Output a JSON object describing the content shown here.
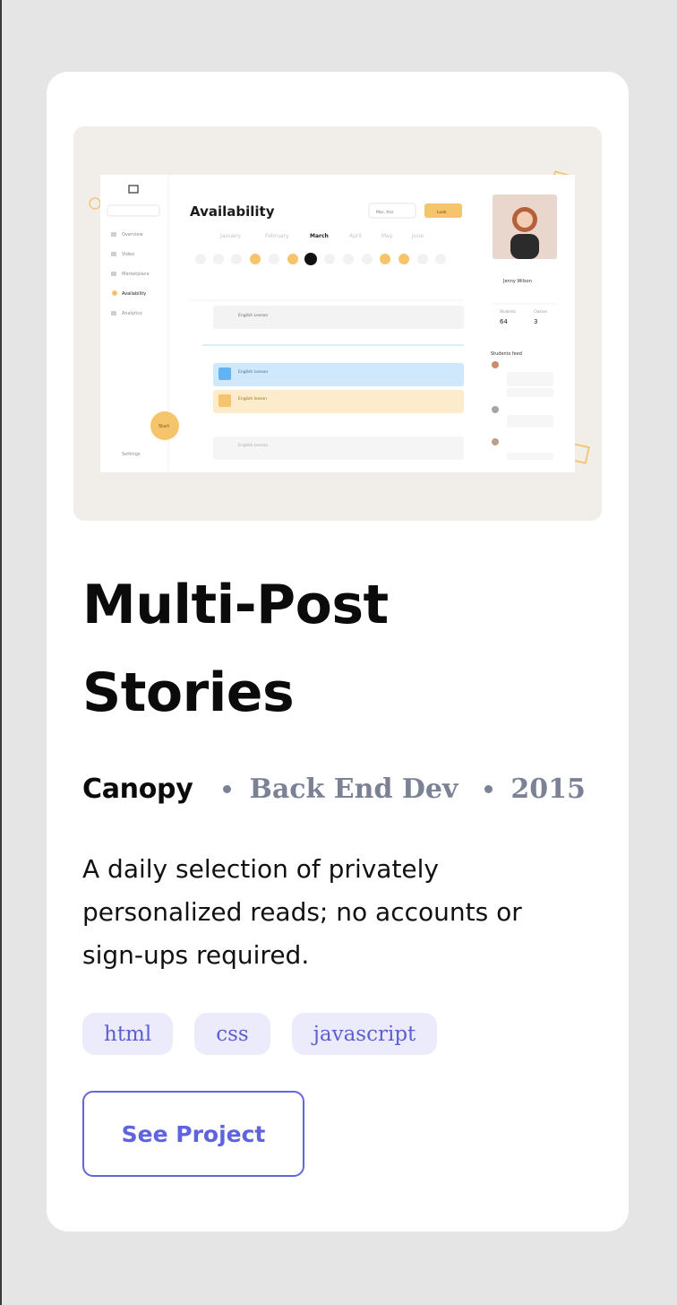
{
  "project": {
    "title": "Multi-Post Stories",
    "client": "Canopy",
    "role": "Back End Dev",
    "year": "2015",
    "description": "A daily selection of privately personalized reads; no accounts or sign-ups required.",
    "tags": [
      "html",
      "css",
      "javascript"
    ],
    "cta_label": "See Project"
  },
  "thumbnail": {
    "heading": "Availability",
    "months": [
      "January",
      "February",
      "March",
      "April",
      "May",
      "June"
    ],
    "active_month": "March",
    "sidebar_items": [
      "Overview",
      "Video",
      "Marketplace",
      "Availability",
      "Analytics"
    ],
    "settings_label": "Settings",
    "start_label": "Start",
    "dropdown_label": "Mar, this",
    "action_label": "Look",
    "lessons": [
      "English Lesson",
      "English Lesson",
      "English lesson",
      "English Lesson"
    ],
    "profile_name": "Jenny Wilson",
    "stats": [
      {
        "label": "Students",
        "value": "64"
      },
      {
        "label": "Classes",
        "value": "3"
      }
    ],
    "feed_title": "Students feed",
    "colors": {
      "accent_yellow": "#f6c46a",
      "accent_blue": "#cfe8fb",
      "accent_orange": "#fdeccc"
    }
  },
  "colors": {
    "page_bg": "#e5e5e5",
    "card_bg": "#ffffff",
    "title": "#0b0b0b",
    "meta": "#7b8295",
    "tag_bg": "#ecebfb",
    "tag_text": "#5d5fd0",
    "cta": "#6166e0"
  }
}
